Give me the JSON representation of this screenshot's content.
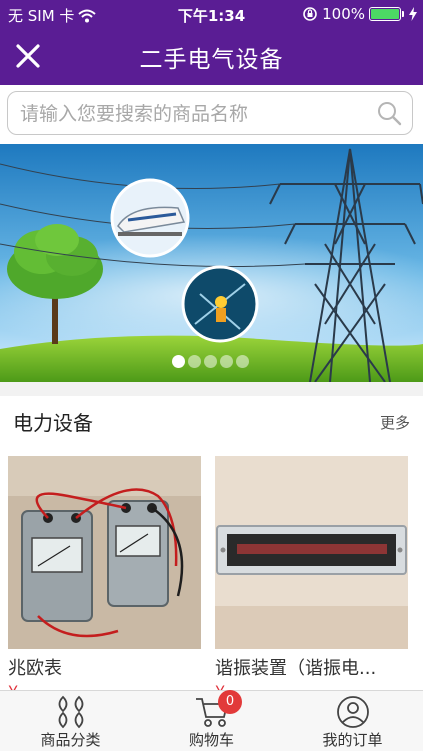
{
  "status_bar": {
    "carrier": "无 SIM 卡",
    "time": "下午1:34",
    "battery": "100%",
    "icons": [
      "wifi-icon",
      "lock-rotation-icon",
      "battery-icon",
      "charging-icon"
    ]
  },
  "nav": {
    "title": "二手电气设备",
    "close_icon": "close-icon"
  },
  "search": {
    "placeholder": "请输入您要搜索的商品名称",
    "value": ""
  },
  "banner": {
    "slide_count": 5,
    "active_index": 0
  },
  "section": {
    "title": "电力设备",
    "more": "更多",
    "products": [
      {
        "name": "兆欧表",
        "price": "¥..."
      },
      {
        "name": "谐振装置（谐振电...",
        "price": "¥..."
      }
    ]
  },
  "tabbar": {
    "tabs": [
      {
        "label": "商品分类",
        "icon": "category-icon"
      },
      {
        "label": "购物车",
        "icon": "cart-icon",
        "badge": "0"
      },
      {
        "label": "我的订单",
        "icon": "user-icon"
      }
    ]
  },
  "colors": {
    "brand": "#5a1d94",
    "badge": "#e23a3a"
  }
}
